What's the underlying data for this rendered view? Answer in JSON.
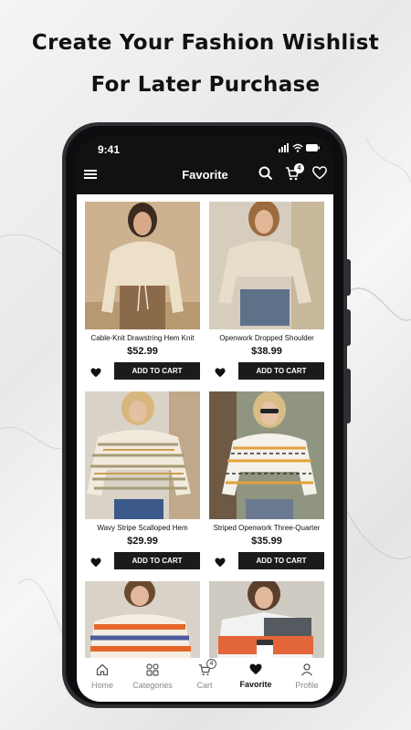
{
  "headline": {
    "line1": "Create Your Fashion Wishlist",
    "line2": "For Later Purchase"
  },
  "status_bar": {
    "time": "9:41"
  },
  "app_bar": {
    "title": "Favorite",
    "cart_count": "4"
  },
  "products": [
    {
      "name": "Cable-Knit Drawstring Hem Knit",
      "price": "$52.99",
      "cta": "ADD TO CART"
    },
    {
      "name": "Openwork Dropped Shoulder",
      "price": "$38.99",
      "cta": "ADD TO CART"
    },
    {
      "name": "Wavy Stripe Scalloped Hem",
      "price": "$29.99",
      "cta": "ADD TO CART"
    },
    {
      "name": "Striped Openwork Three-Quarter",
      "price": "$35.99",
      "cta": "ADD TO CART"
    }
  ],
  "tabs": [
    {
      "label": "Home",
      "icon": "home-icon"
    },
    {
      "label": "Categories",
      "icon": "categories-icon"
    },
    {
      "label": "Cart",
      "icon": "cart-icon",
      "badge": "4"
    },
    {
      "label": "Favorite",
      "icon": "heart-icon"
    },
    {
      "label": "Profile",
      "icon": "profile-icon"
    }
  ],
  "colors": {
    "accent": "#1b1b1d",
    "phone_frame": "#2d2f33",
    "background": "#efefef"
  }
}
